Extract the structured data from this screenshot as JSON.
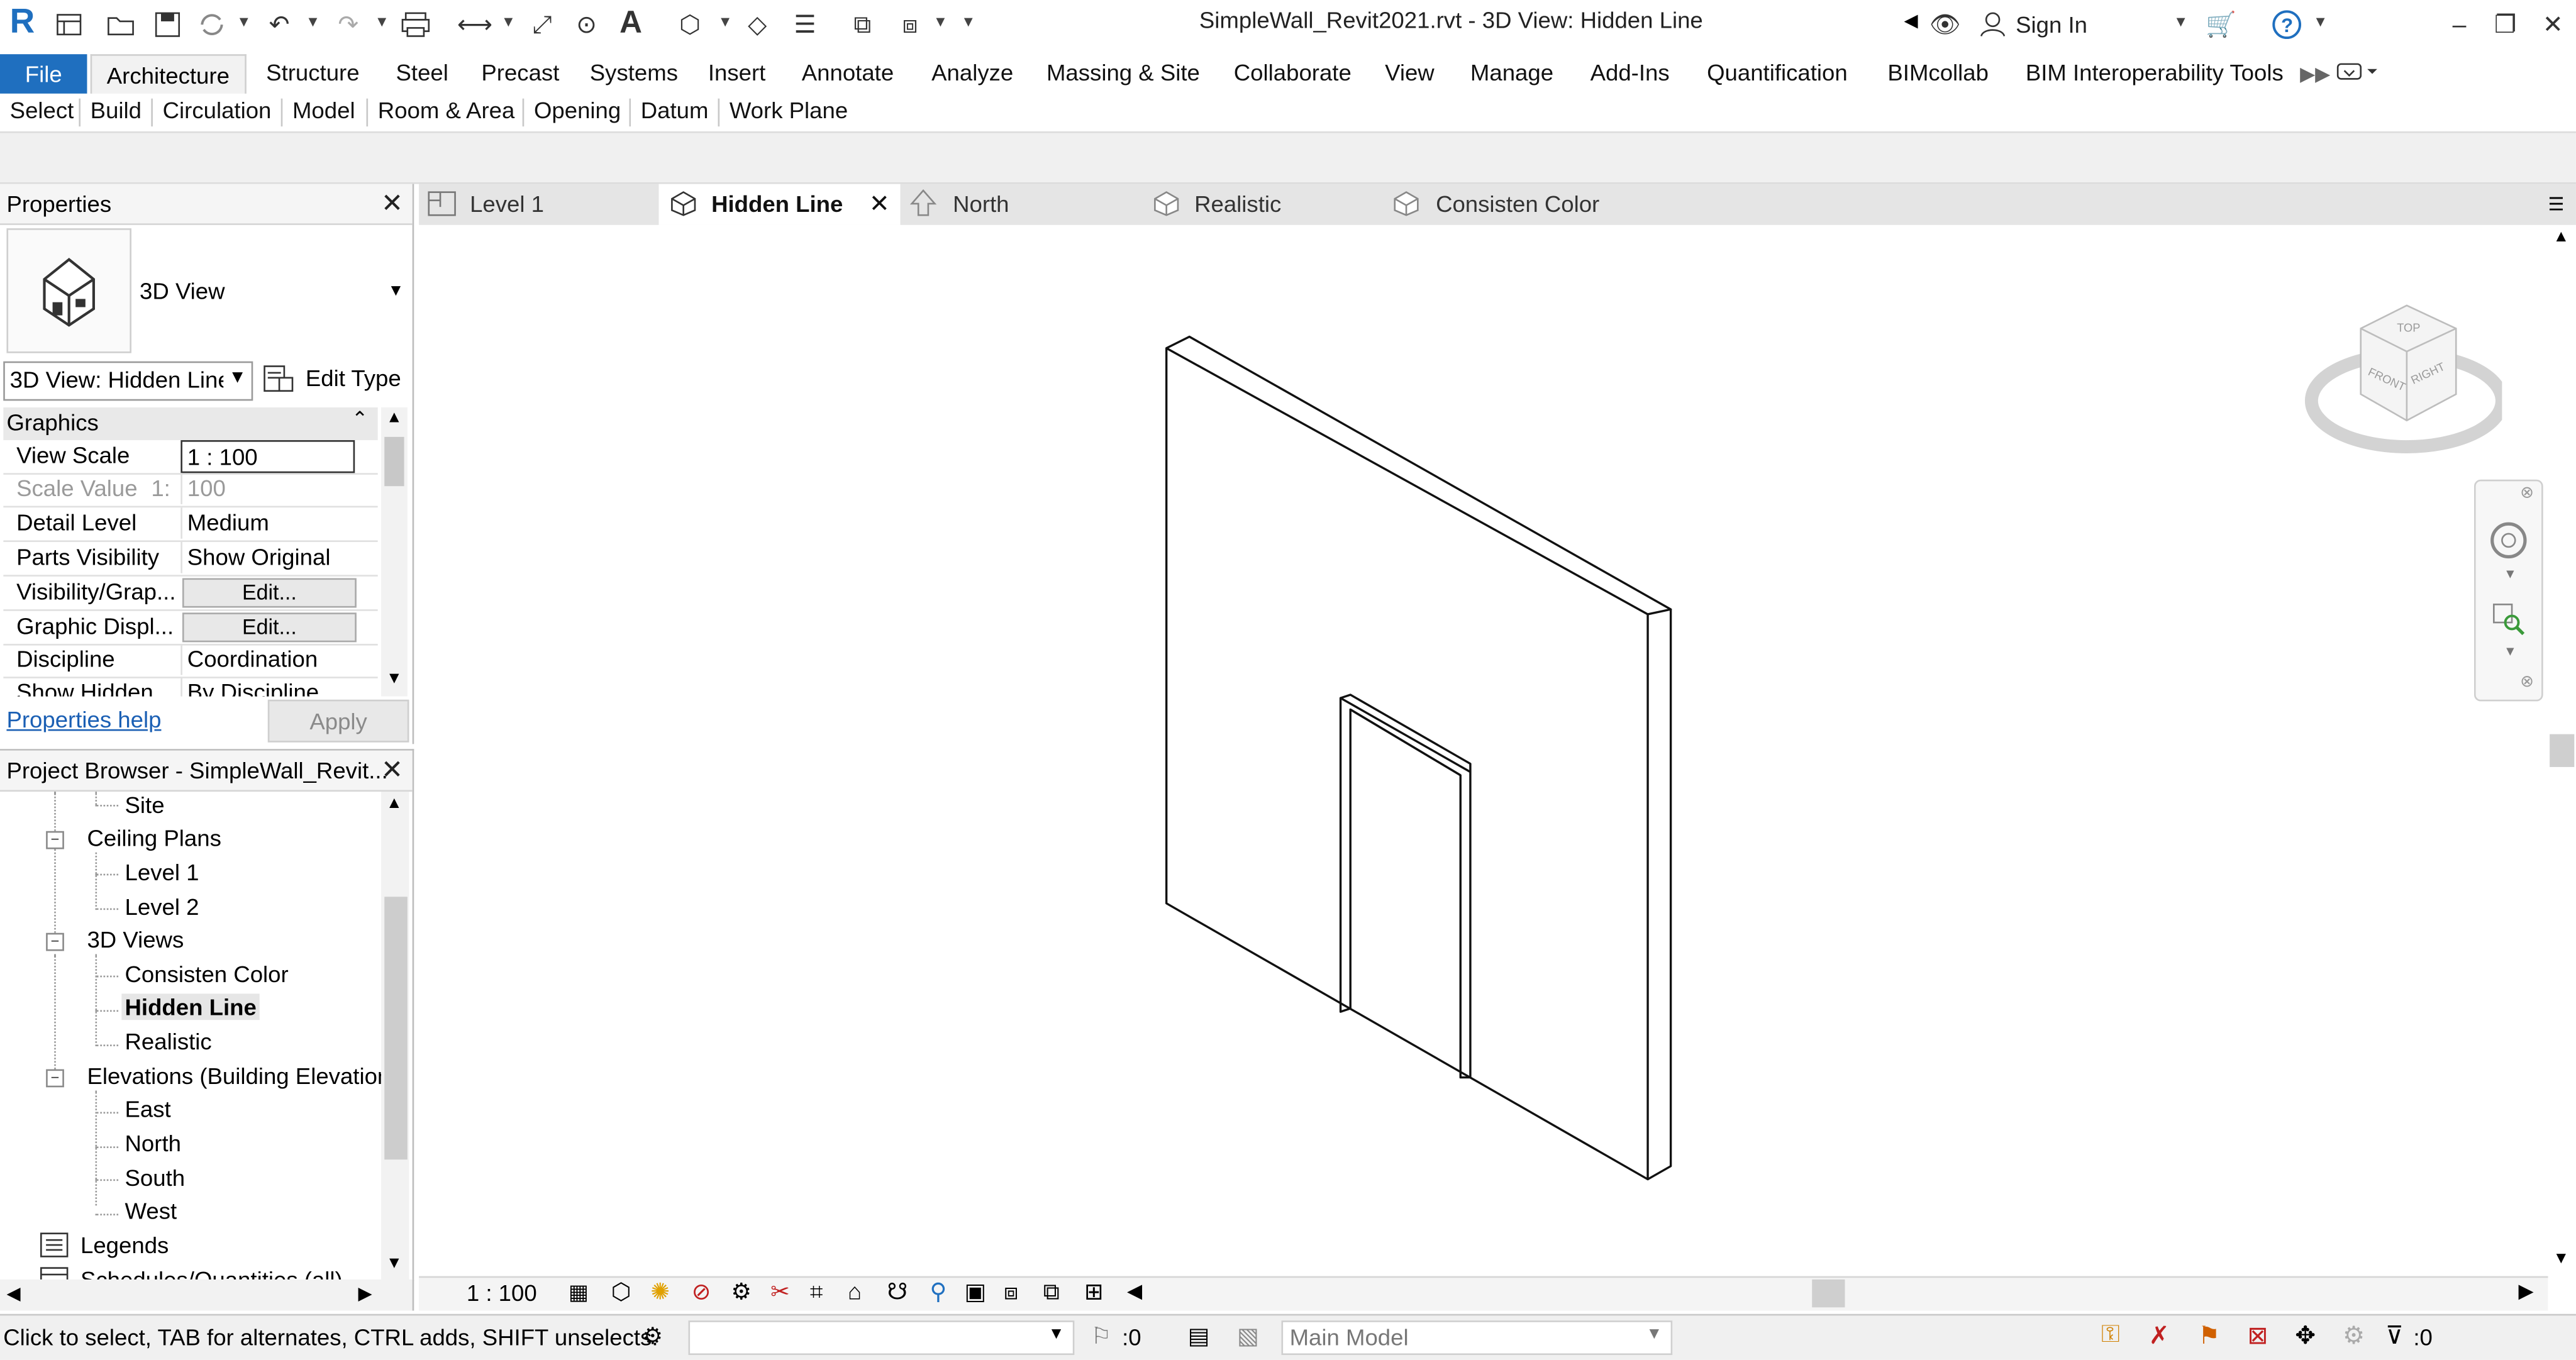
{
  "app": {
    "logo_letter": "R",
    "title": "SimpleWall_Revit2021.rvt - 3D View: Hidden Line",
    "sign_in": "Sign In"
  },
  "ribbon": {
    "file": "File",
    "tabs": [
      "Architecture",
      "Structure",
      "Steel",
      "Precast",
      "Systems",
      "Insert",
      "Annotate",
      "Analyze",
      "Massing & Site",
      "Collaborate",
      "View",
      "Manage",
      "Add-Ins",
      "Quantification",
      "BIMcollab",
      "BIM Interoperability Tools"
    ],
    "panels": [
      "Select",
      "Build",
      "Circulation",
      "Model",
      "Room & Area",
      "Opening",
      "Datum",
      "Work Plane"
    ]
  },
  "properties": {
    "title": "Properties",
    "type_name": "3D View",
    "instance": "3D View: Hidden Line",
    "edit_type": "Edit Type",
    "group": "Graphics",
    "rows": [
      {
        "name": "View Scale",
        "value": "1 : 100"
      },
      {
        "name": "Scale Value",
        "prefix": "1:",
        "value": "100"
      },
      {
        "name": "Detail Level",
        "value": "Medium"
      },
      {
        "name": "Parts Visibility",
        "value": "Show Original"
      },
      {
        "name": "Visibility/Grap...",
        "value": "Edit..."
      },
      {
        "name": "Graphic Displ...",
        "value": "Edit..."
      },
      {
        "name": "Discipline",
        "value": "Coordination"
      },
      {
        "name": "Show Hidden ...",
        "value": "By Discipline"
      }
    ],
    "help": "Properties help",
    "apply": "Apply"
  },
  "browser": {
    "title": "Project Browser - SimpleWall_Revit...",
    "items": {
      "site": "Site",
      "ceiling_plans": "Ceiling Plans",
      "level1": "Level 1",
      "level2": "Level 2",
      "views3d": "3D Views",
      "consisten_color": "Consisten Color",
      "hidden_line": "Hidden Line",
      "realistic": "Realistic",
      "elevations": "Elevations (Building Elevation)",
      "east": "East",
      "north": "North",
      "south": "South",
      "west": "West",
      "legends": "Legends",
      "schedules": "Schedules/Quantities (all)"
    }
  },
  "view_tabs": [
    {
      "label": "Level 1",
      "icon": "floor-plan-icon"
    },
    {
      "label": "Hidden Line",
      "icon": "3d-view-icon",
      "active": true
    },
    {
      "label": "North",
      "icon": "elevation-icon"
    },
    {
      "label": "Realistic",
      "icon": "3d-view-icon"
    },
    {
      "label": "Consisten Color",
      "icon": "3d-view-icon"
    }
  ],
  "viewcube": {
    "top": "TOP",
    "front": "FRONT",
    "right": "RIGHT"
  },
  "view_controls": {
    "scale": "1 : 100"
  },
  "status": {
    "text": "Click to select, TAB for alternates, CTRL adds, SHIFT unselects.",
    "zero_a": ":0",
    "model": "Main Model",
    "zero_b": ":0"
  },
  "colors": {
    "file_tab": "#1f6fbf",
    "link": "#1a5fb4",
    "accent_cube": "#dcdcdc"
  }
}
